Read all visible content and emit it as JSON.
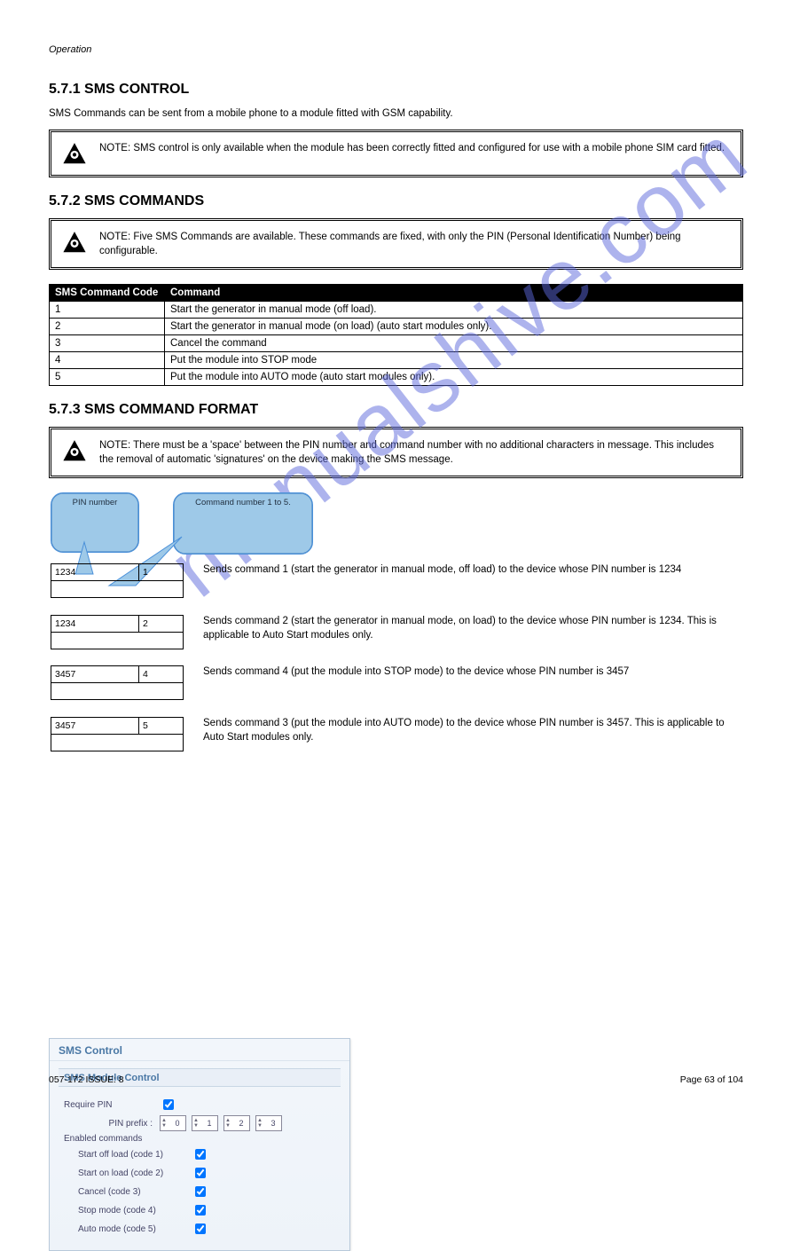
{
  "header": {
    "left": "Operation",
    "right": ""
  },
  "section1": {
    "title": "5.7.1 SMS CONTROL",
    "intro": "SMS Commands can be sent from a mobile phone to a module fitted with GSM capability.",
    "note": "NOTE: SMS control is only available when the module has been correctly fitted and configured for use with a mobile phone SIM card fitted."
  },
  "section2": {
    "title": "5.7.2 SMS COMMANDS",
    "note": "NOTE: Five SMS Commands are available. These commands are fixed, with only the PIN (Personal Identification Number) being configurable.",
    "table_headers": {
      "code": "SMS Command Code",
      "command": "Command"
    },
    "rows": [
      {
        "code": "1",
        "command": "Start the generator in manual mode (off load)."
      },
      {
        "code": "2",
        "command": "Start the generator in manual mode (on load) (auto start modules only)."
      },
      {
        "code": "3",
        "command": "Cancel the command"
      },
      {
        "code": "4",
        "command": "Put the module into STOP mode"
      },
      {
        "code": "5",
        "command": "Put the module into AUTO mode (auto start modules only)."
      }
    ]
  },
  "section3": {
    "title": "5.7.3 SMS COMMAND FORMAT",
    "note": "NOTE: There must be a 'space' between the PIN number and command number with no additional characters in message. This includes the removal of automatic 'signatures' on the device making the SMS message.",
    "callout_pin": "PIN number",
    "callout_cmd": "Command number 1 to 5.",
    "examples": [
      {
        "pin": "1234",
        "num": "1",
        "desc": "Sends command 1 (start the generator in manual mode, off load) to the device whose PIN number is 1234"
      },
      {
        "pin": "1234",
        "num": "2",
        "desc": "Sends command 2 (start the generator in manual mode, on load) to the device whose PIN number is 1234. This is applicable to Auto Start modules only."
      },
      {
        "pin": "3457",
        "num": "4",
        "desc": "Sends command 4 (put the module into STOP mode) to the device whose PIN number is 3457"
      },
      {
        "pin": "3457",
        "num": "5",
        "desc": "Sends command 3 (put the module into AUTO mode) to the device whose PIN number is 3457. This is applicable to Auto Start modules only."
      }
    ]
  },
  "sms_panel": {
    "title": "SMS Control",
    "subtitle": "SMS Module Control",
    "require_pin_label": "Require PIN",
    "pin_prefix_label": "PIN prefix :",
    "pin_values": [
      "0",
      "1",
      "2",
      "3"
    ],
    "enabled_label": "Enabled commands",
    "commands": [
      "Start off load (code 1)",
      "Start on load (code 2)",
      "Cancel (code 3)",
      "Stop mode (code 4)",
      "Auto mode (code 5)"
    ]
  },
  "footer": {
    "left": "057-172 ISSUE: 8",
    "center": "",
    "right": "Page 63 of 104"
  },
  "watermark": "manualshive.com"
}
